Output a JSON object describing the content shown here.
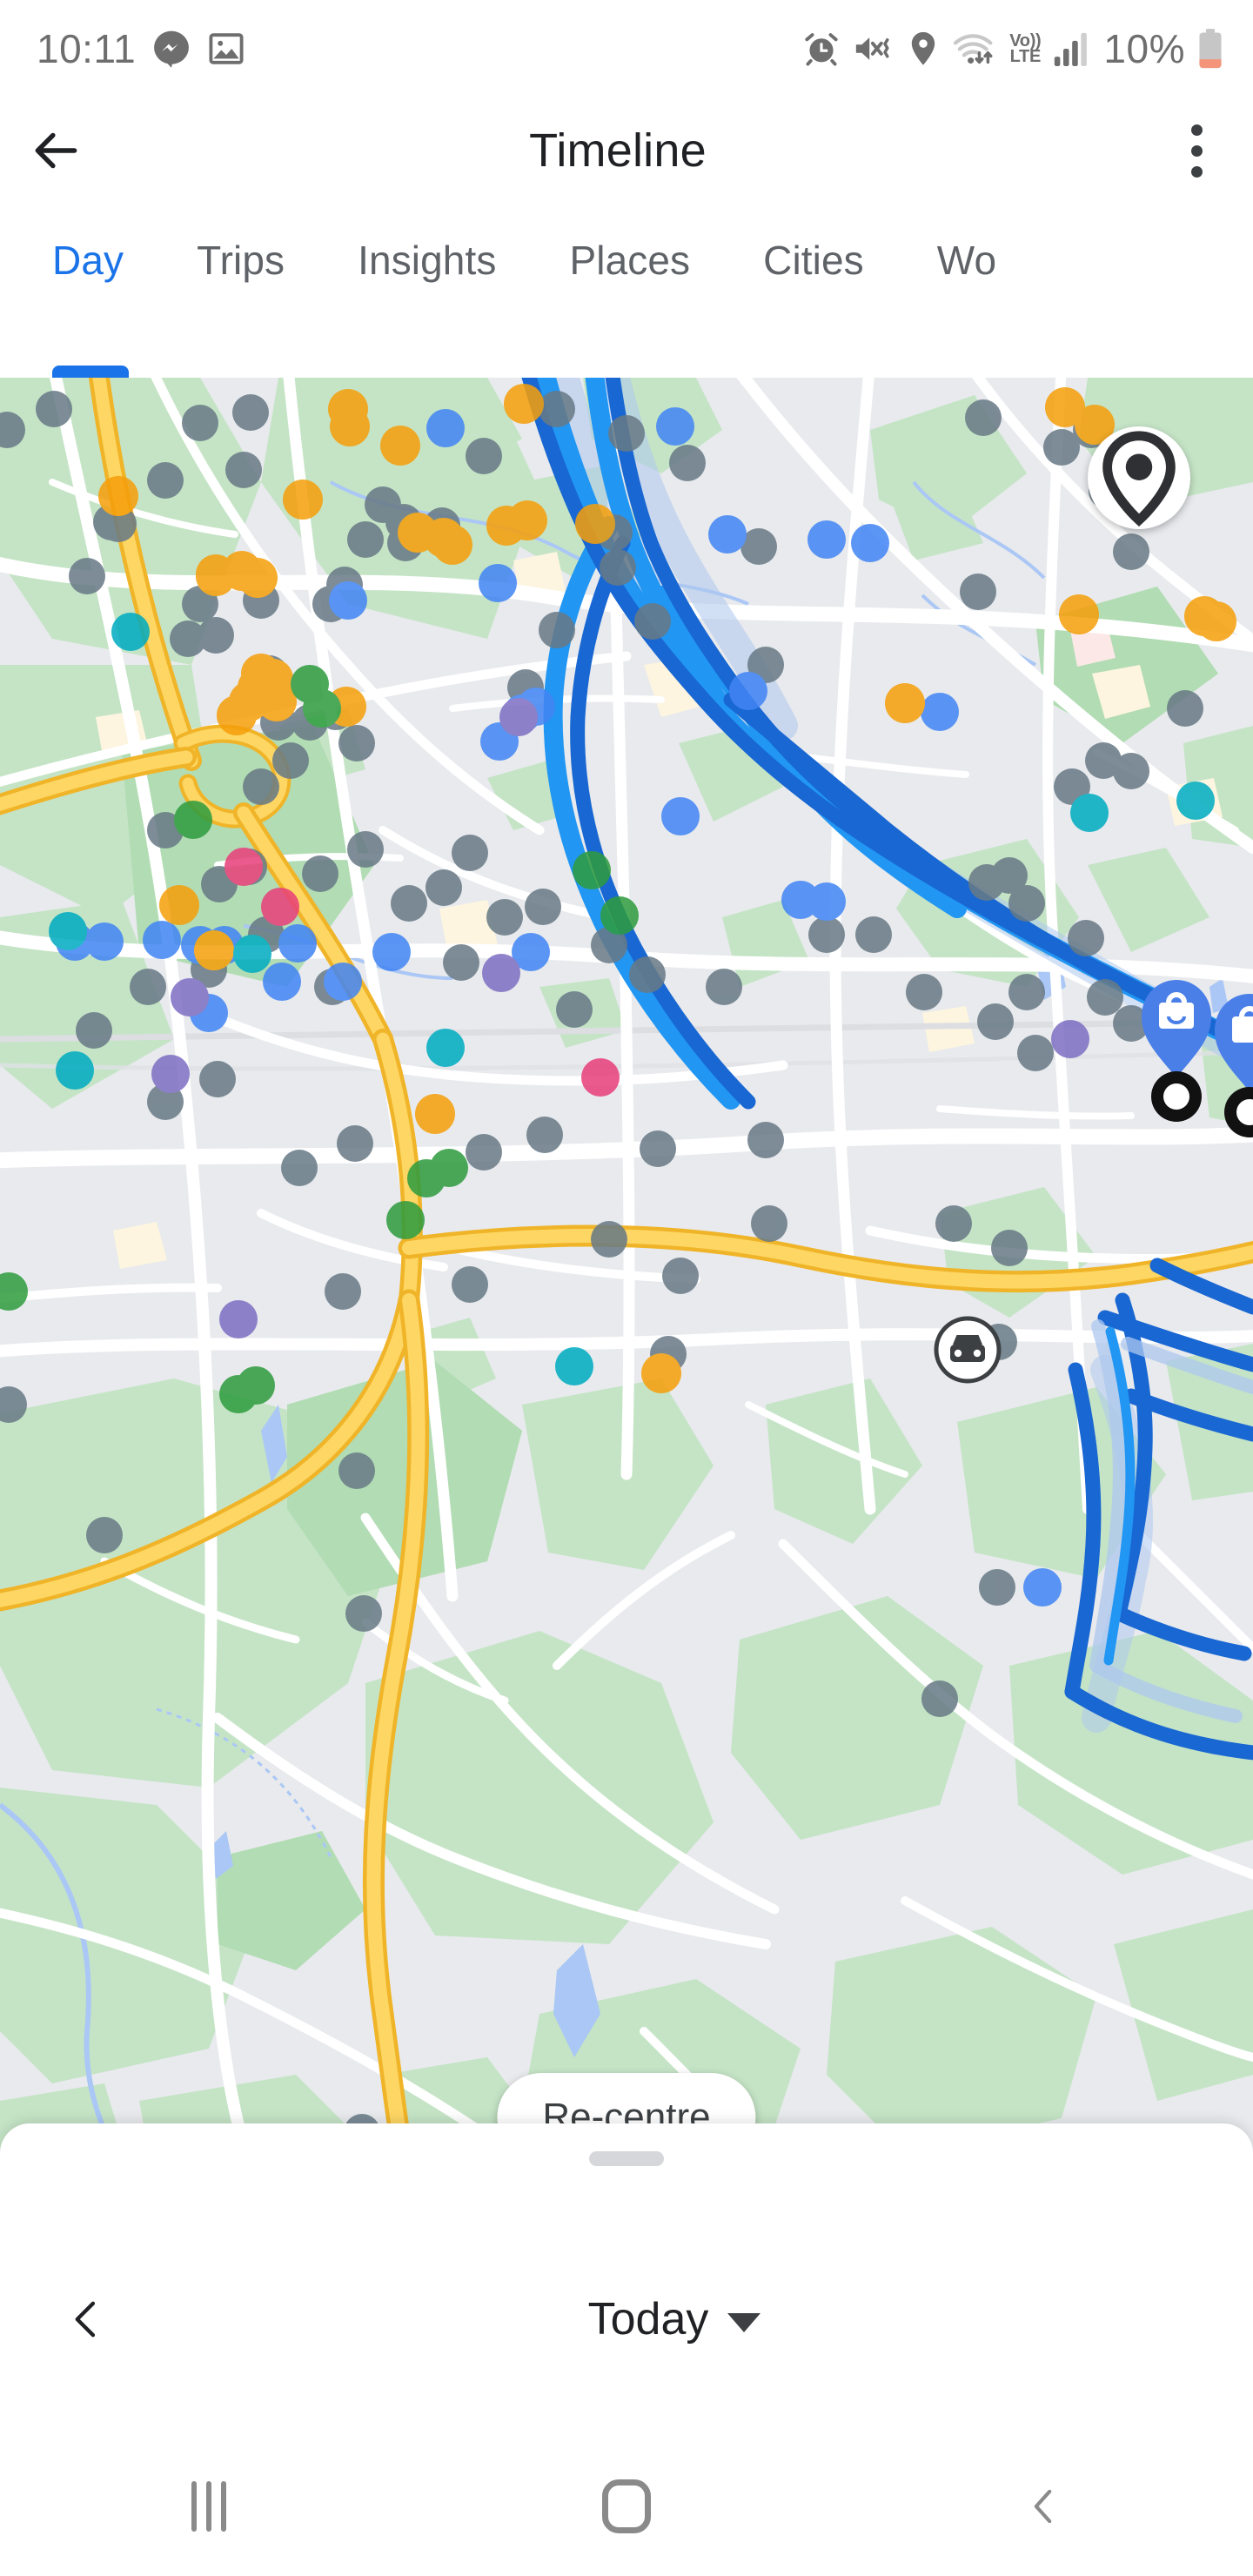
{
  "status_bar": {
    "time": "10:11",
    "battery_percent": "10%",
    "left_icons": [
      "messenger-icon",
      "photos-icon"
    ],
    "right_icons": [
      "alarm-icon",
      "mute-vibrate-icon",
      "location-icon",
      "wifi-icon",
      "volte-icon",
      "signal-icon",
      "battery-icon"
    ],
    "volte_top": "Vo))",
    "volte_bottom": "LTE",
    "text_color": "#6e6e6e",
    "battery_low_color": "#f4947a"
  },
  "app_bar": {
    "title": "Timeline",
    "back_icon": "back-arrow-icon",
    "overflow_icon": "overflow-menu-icon"
  },
  "tabs": {
    "active_index": 0,
    "accent_color": "#1a73e8",
    "inactive_color": "#5f6368",
    "items": [
      {
        "label": "Day"
      },
      {
        "label": "Trips"
      },
      {
        "label": "Insights"
      },
      {
        "label": "Places"
      },
      {
        "label": "Cities"
      },
      {
        "label": "Wo"
      }
    ]
  },
  "map": {
    "recentre_label": "Re-centre",
    "location_fab_icon": "location-pin-icon",
    "travel_mode_icon": "car-icon",
    "place_pin_icon": "shopping-bag-icon",
    "colors": {
      "land": "#e8eaed",
      "green_area": "#c5e4c6",
      "green_area_dark": "#b2dcb4",
      "road": "#ffffff",
      "highway_fill": "#fdd663",
      "highway_stroke": "#f0b429",
      "water": "#aac7f5",
      "route_dark_blue": "#1967d2",
      "route_bright_blue": "#2196f3",
      "route_pale_blue": "#aec8ef",
      "dot_gray": "#687a86",
      "dot_orange": "#f59f0b",
      "dot_blue": "#4285f4",
      "dot_green": "#2e9c3e",
      "dot_cyan": "#00acc1",
      "dot_pink": "#e8407a",
      "dot_purple": "#7e6fc4"
    }
  },
  "bottom_sheet": {
    "prev_icon": "chevron-left-icon",
    "date_label": "Today",
    "dropdown_icon": "caret-down-icon",
    "handle": "drag-handle"
  },
  "nav_bar": {
    "recents_icon": "recents-icon",
    "home_icon": "home-icon",
    "back_icon": "nav-back-icon",
    "color": "#8a8a8a"
  }
}
